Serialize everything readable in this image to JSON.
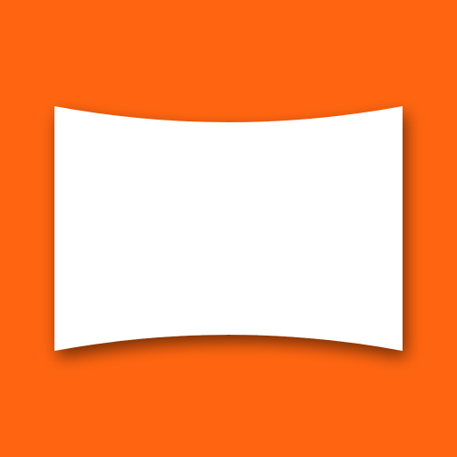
{
  "icon": {
    "name": "panorama-icon",
    "colors": {
      "background": "#FF6510",
      "panel": "#FFFFFF",
      "shadow": "#8A2E00"
    }
  }
}
